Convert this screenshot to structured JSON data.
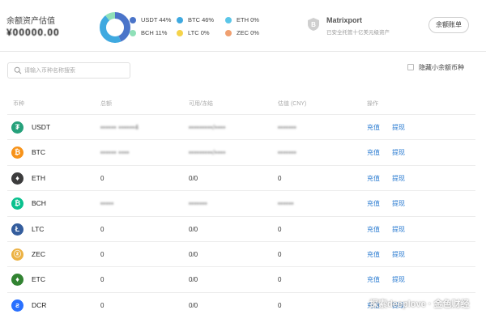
{
  "header": {
    "balance_label": "余额资产估值",
    "balance_value": "¥00000.00",
    "allocation": [
      {
        "coin": "USDT",
        "percent": 44,
        "label": "USDT 44%",
        "color": "#4a74c9"
      },
      {
        "coin": "BTC",
        "percent": 46,
        "label": "BTC 46%",
        "color": "#3fa9e0"
      },
      {
        "coin": "ETH",
        "percent": 0,
        "label": "ETH 0%",
        "color": "#5bc6e8"
      },
      {
        "coin": "BCH",
        "percent": 11,
        "label": "BCH 11%",
        "color": "#8fe0b8"
      },
      {
        "coin": "LTC",
        "percent": 0,
        "label": "LTC 0%",
        "color": "#f5d34a"
      },
      {
        "coin": "ZEC",
        "percent": 0,
        "label": "ZEC 0%",
        "color": "#f0a070"
      }
    ],
    "custodian_name": "Matrixport",
    "custodian_desc": "已安全托管十亿美元级资产",
    "ledger_button": "余额账单"
  },
  "search": {
    "placeholder": "请输入币种名称搜索",
    "value": ""
  },
  "hide_small": {
    "label": "隐藏小余额币种",
    "checked": false
  },
  "table": {
    "columns": {
      "coin": "币种",
      "total": "总额",
      "available_frozen": "可用/冻结",
      "valuation": "估值 (CNY)",
      "action": "操作"
    },
    "deposit_label": "充值",
    "withdraw_label": "提现",
    "rows": [
      {
        "coin": "USDT",
        "icon": "tether-icon",
        "icon_color": "#26a17b",
        "glyph": "₮",
        "total": "•••••• ••••••4",
        "available_frozen": "•••••••••/••••",
        "valuation": "•••••••"
      },
      {
        "coin": "BTC",
        "icon": "bitcoin-icon",
        "icon_color": "#f7931a",
        "glyph": "₿",
        "total": "•••••• ••••",
        "available_frozen": "•••••••••/••••",
        "valuation": "•••••••"
      },
      {
        "coin": "ETH",
        "icon": "ethereum-icon",
        "icon_color": "#3c3c3d",
        "glyph": "♦",
        "total": "0",
        "available_frozen": "0/0",
        "valuation": "0"
      },
      {
        "coin": "BCH",
        "icon": "bitcoin-cash-icon",
        "icon_color": "#0ac18e",
        "glyph": "₿",
        "total": "•••••",
        "available_frozen": "•••••••",
        "valuation": "••••••"
      },
      {
        "coin": "LTC",
        "icon": "litecoin-icon",
        "icon_color": "#345d9d",
        "glyph": "Ł",
        "total": "0",
        "available_frozen": "0/0",
        "valuation": "0"
      },
      {
        "coin": "ZEC",
        "icon": "zcash-icon",
        "icon_color": "#ecb244",
        "glyph": "ⓩ",
        "total": "0",
        "available_frozen": "0/0",
        "valuation": "0"
      },
      {
        "coin": "ETC",
        "icon": "ethereum-classic-icon",
        "icon_color": "#328332",
        "glyph": "♦",
        "total": "0",
        "available_frozen": "0/0",
        "valuation": "0"
      },
      {
        "coin": "DCR",
        "icon": "decred-icon",
        "icon_color": "#2970ff",
        "glyph": "ƨ",
        "total": "0",
        "available_frozen": "0/0",
        "valuation": "0"
      }
    ]
  },
  "watermark": "探索deeplove · 金色财经"
}
